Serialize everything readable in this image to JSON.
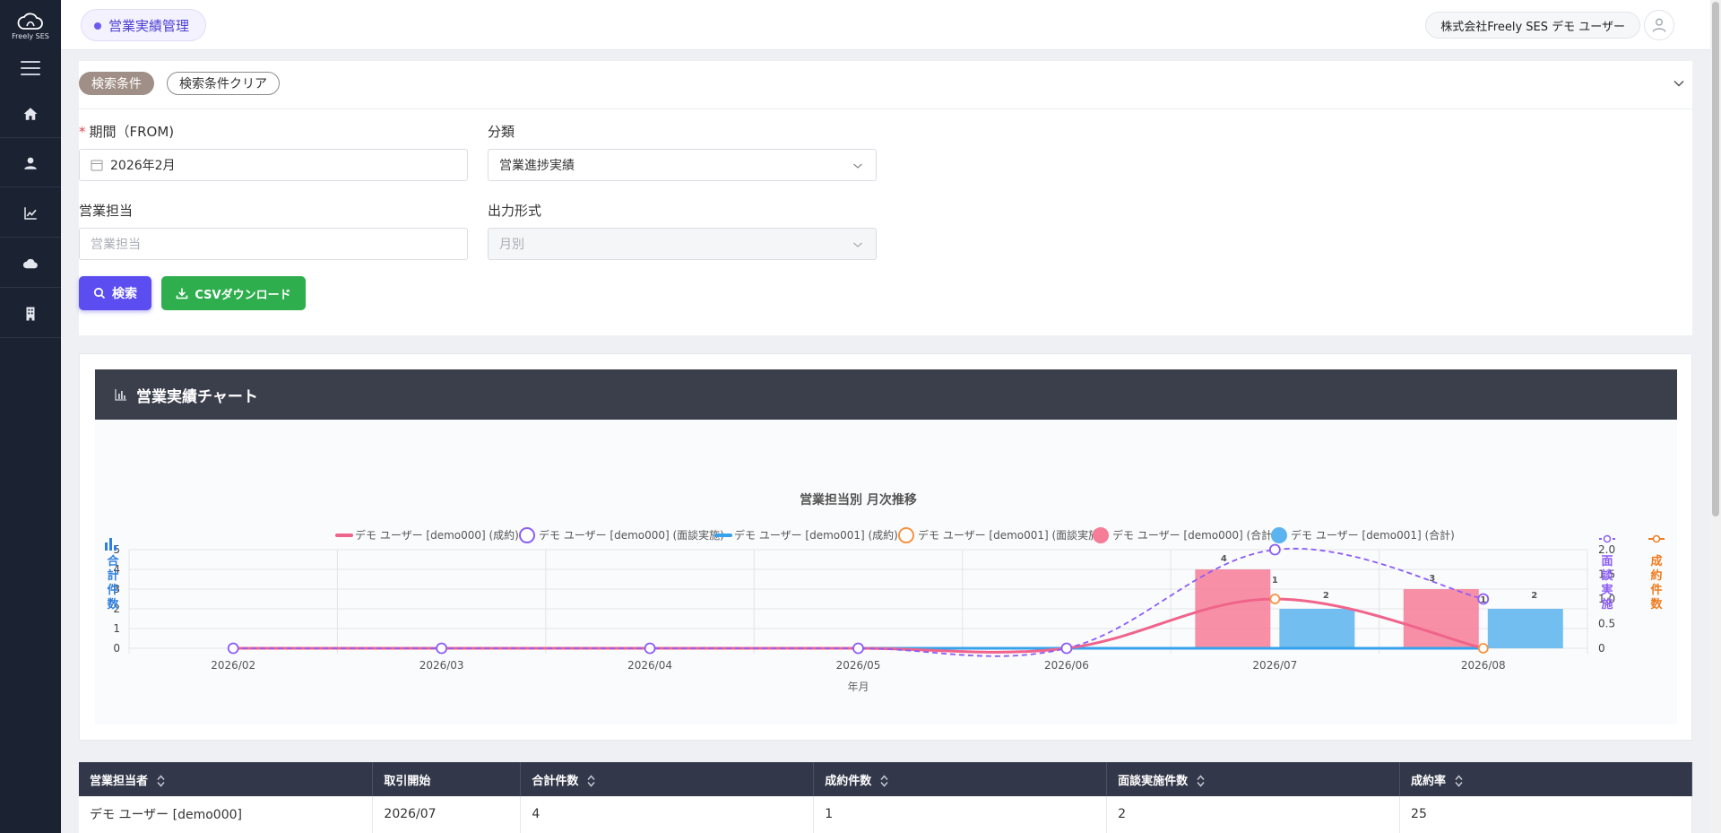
{
  "sidebar": {
    "logo_text": "Freely SES"
  },
  "header": {
    "page_title": "営業実績管理",
    "user_label": "株式会社Freely SES デモ ユーザー"
  },
  "search": {
    "condition_tag": "検索条件",
    "clear_button": "検索条件クリア",
    "period_label": "期間（FROM)",
    "period_value": "2026年2月",
    "category_label": "分類",
    "category_value": "営業進捗実績",
    "rep_label": "営業担当",
    "rep_placeholder": "営業担当",
    "format_label": "出力形式",
    "format_placeholder": "月別",
    "search_button": "検索",
    "csv_button": "CSVダウンロード"
  },
  "chart_section": {
    "title": "営業実績チャート"
  },
  "chart_data": {
    "type": "bar",
    "title": "営業担当別 月次推移",
    "xlabel": "年月",
    "ylabel_left": "合計件数",
    "ylabel_right_1": "面談実施",
    "ylabel_right_2": "成約件数",
    "categories": [
      "2026/02",
      "2026/03",
      "2026/04",
      "2026/05",
      "2026/06",
      "2026/07",
      "2026/08"
    ],
    "y_left_ticks": [
      "0",
      "1",
      "2",
      "3",
      "4",
      "5"
    ],
    "y_right_ticks": [
      "0",
      "0.5",
      "1.0",
      "1.5",
      "2.0"
    ],
    "ylim_left": [
      0,
      5
    ],
    "ylim_right": [
      0,
      2
    ],
    "legend_position": "top",
    "grid": true,
    "series": [
      {
        "name": "デモ ユーザー [demo000] (成約)",
        "kind": "line",
        "axis": "right",
        "color": "#f0648c",
        "values": [
          0,
          0,
          0,
          0,
          0,
          1,
          0
        ]
      },
      {
        "name": "デモ ユーザー [demo000] (面談実施)",
        "kind": "line-dashed",
        "axis": "right",
        "color": "#8b5cf6",
        "values": [
          0,
          0,
          0,
          0,
          0,
          2,
          1
        ]
      },
      {
        "name": "デモ ユーザー [demo001] (成約)",
        "kind": "line",
        "axis": "right",
        "color": "#36a2eb",
        "values": [
          0,
          0,
          0,
          0,
          0,
          0,
          0
        ]
      },
      {
        "name": "デモ ユーザー [demo001] (面談実施)",
        "kind": "points",
        "axis": "right",
        "color": "#f5923e",
        "values": [
          0,
          0,
          0,
          0,
          0,
          1,
          0
        ]
      },
      {
        "name": "デモ ユーザー [demo000] (合計)",
        "kind": "bar",
        "axis": "left",
        "color": "#f67c97",
        "values": [
          0,
          0,
          0,
          0,
          0,
          4,
          3
        ]
      },
      {
        "name": "デモ ユーザー [demo001] (合計)",
        "kind": "bar",
        "axis": "left",
        "color": "#5bb3ef",
        "values": [
          0,
          0,
          0,
          0,
          0,
          2,
          2
        ]
      }
    ],
    "annotations": [
      {
        "category": "2026/07",
        "labels": [
          "4",
          "1",
          "2"
        ]
      },
      {
        "category": "2026/08",
        "labels": [
          "3",
          "1",
          "2"
        ]
      }
    ]
  },
  "table": {
    "headers": [
      "営業担当者",
      "取引開始",
      "合計件数",
      "成約件数",
      "面談実施件数",
      "成約率"
    ],
    "rows": [
      [
        "デモ ユーザー [demo000]",
        "2026/07",
        "4",
        "1",
        "2",
        "25"
      ]
    ]
  }
}
